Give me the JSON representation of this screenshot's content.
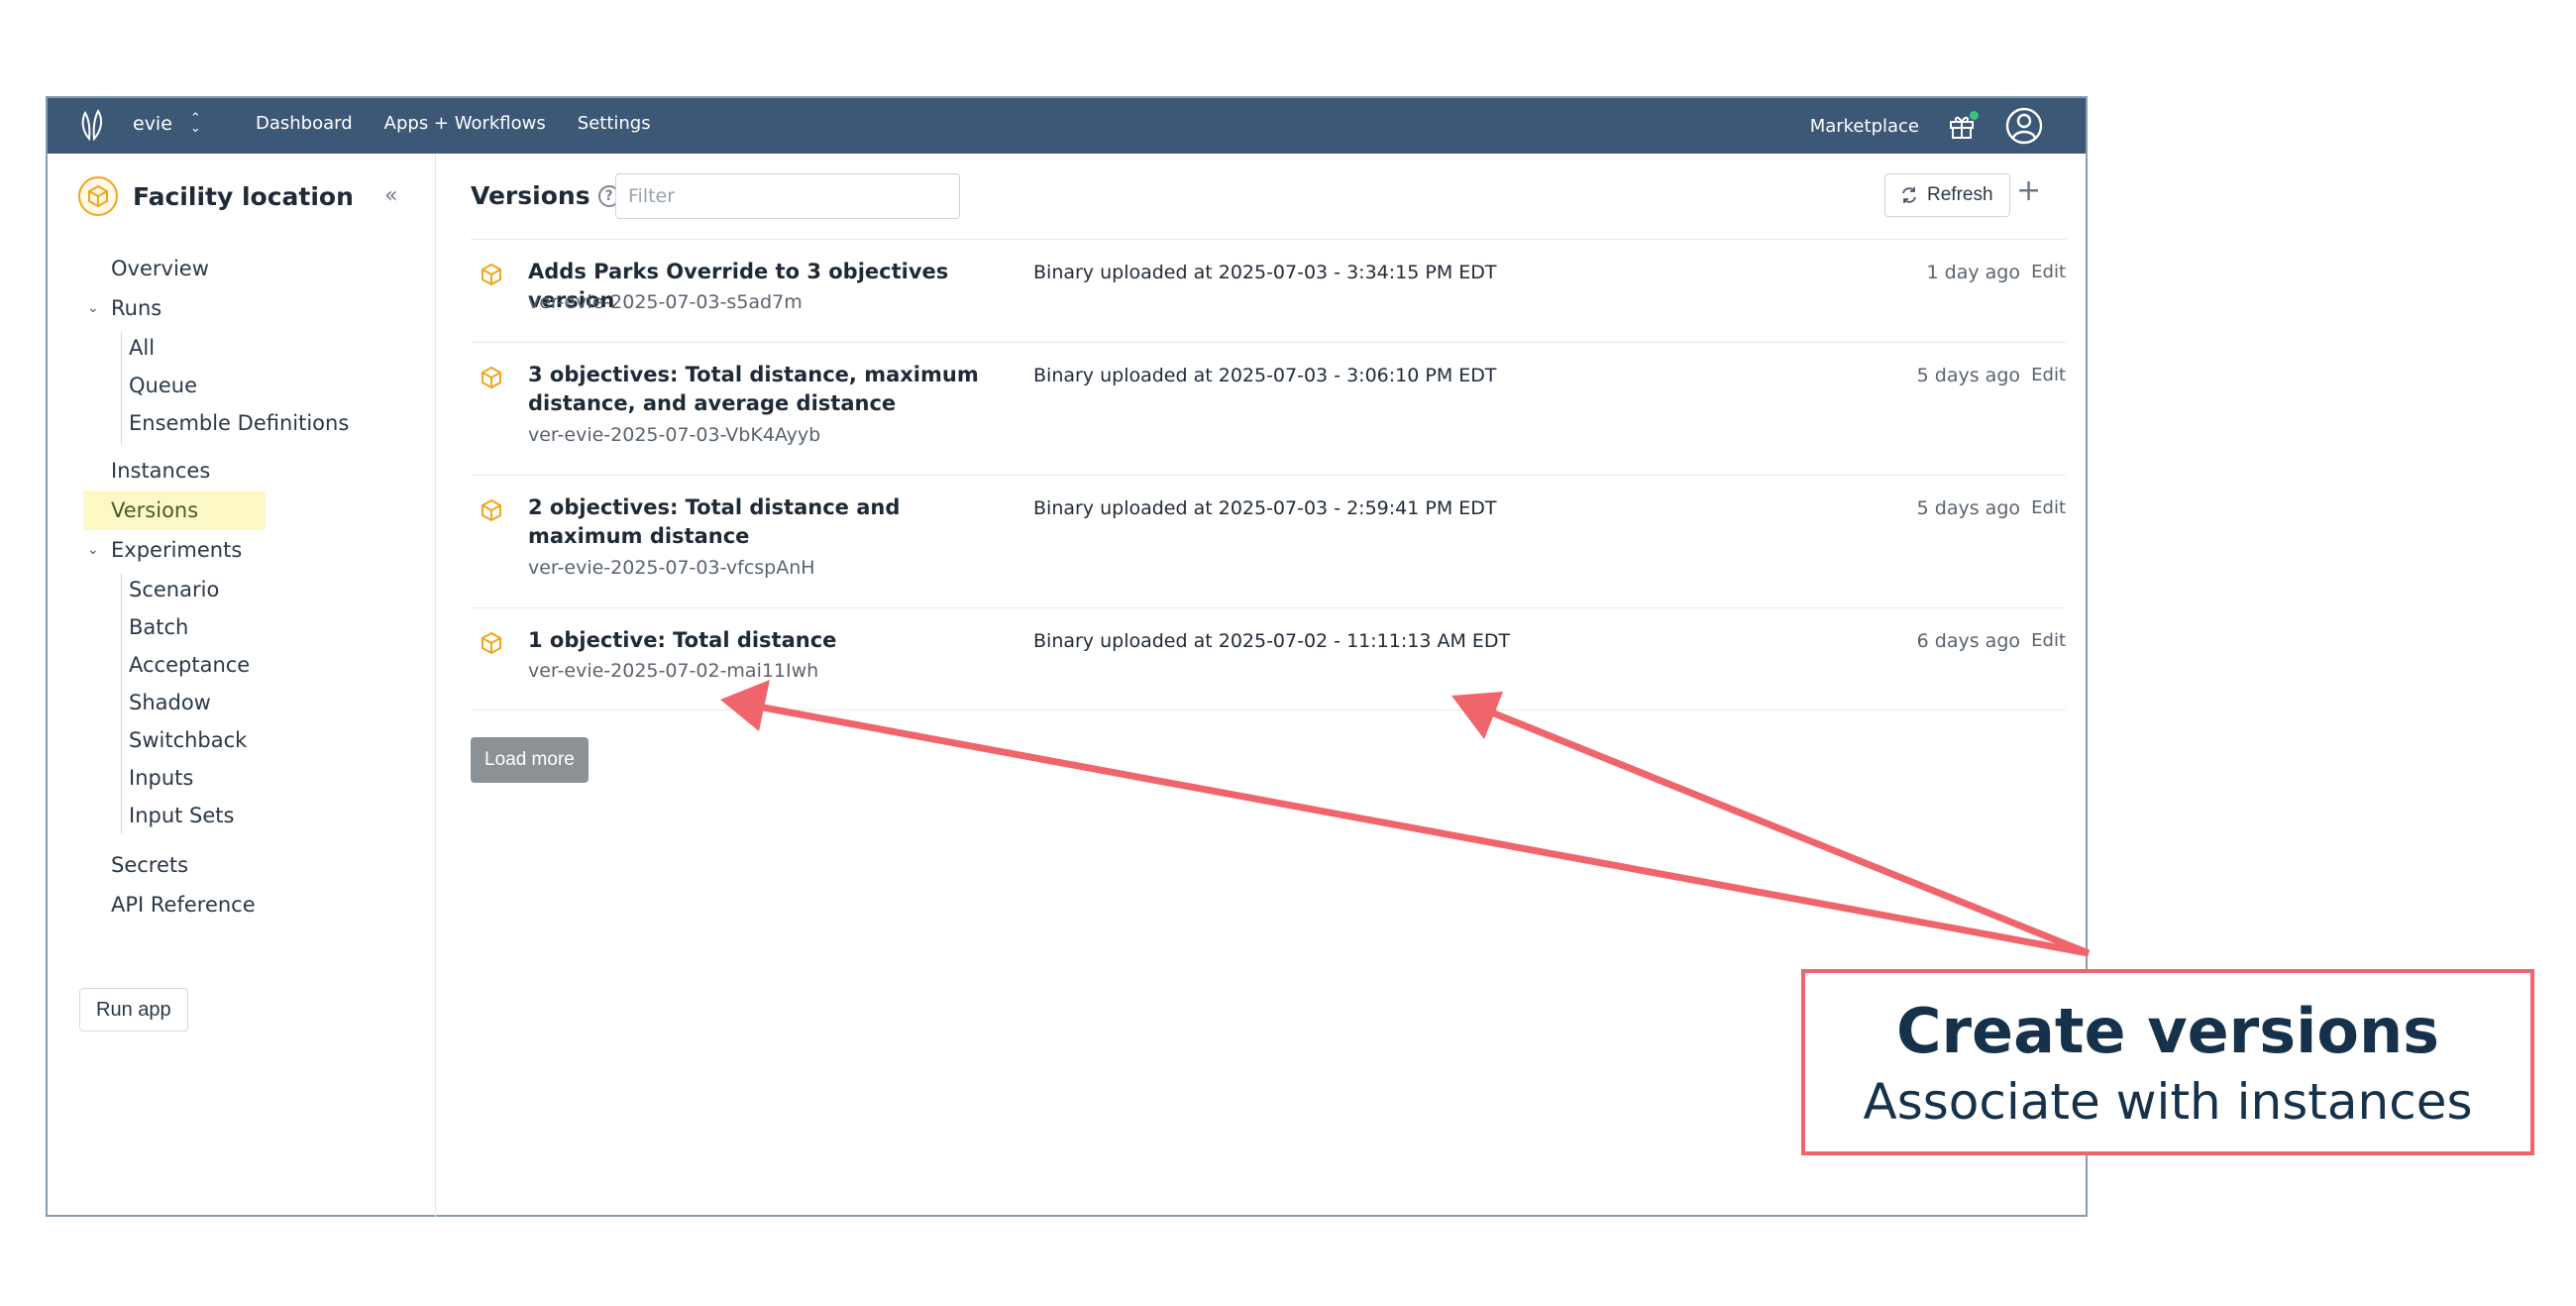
{
  "topnav": {
    "account": "evie",
    "links": [
      "Dashboard",
      "Apps + Workflows",
      "Settings"
    ],
    "marketplace": "Marketplace"
  },
  "sidebar": {
    "app_title": "Facility location",
    "items": [
      "Overview",
      "Runs",
      "All",
      "Queue",
      "Ensemble Definitions",
      "Instances",
      "Versions",
      "Experiments",
      "Scenario",
      "Batch",
      "Acceptance",
      "Shadow",
      "Switchback",
      "Inputs",
      "Input Sets",
      "Secrets",
      "API Reference"
    ],
    "run_button": "Run app"
  },
  "versions": {
    "heading": "Versions",
    "filter_placeholder": "Filter",
    "refresh_label": "Refresh",
    "load_more": "Load more",
    "edit_label": "Edit",
    "rows": [
      {
        "title": "Adds Parks Override to 3 objectives version",
        "id": "ver-evie-2025-07-03-s5ad7m",
        "uploaded": "Binary uploaded at 2025-07-03 - 3:34:15 PM EDT",
        "ago": "1 day ago"
      },
      {
        "title": "3 objectives: Total distance, maximum distance, and average distance",
        "id": "ver-evie-2025-07-03-VbK4Ayyb",
        "uploaded": "Binary uploaded at 2025-07-03 - 3:06:10 PM EDT",
        "ago": "5 days ago"
      },
      {
        "title": "2 objectives: Total distance and maximum distance",
        "id": "ver-evie-2025-07-03-vfcspAnH",
        "uploaded": "Binary uploaded at 2025-07-03 - 2:59:41 PM EDT",
        "ago": "5 days ago"
      },
      {
        "title": "1 objective: Total distance",
        "id": "ver-evie-2025-07-02-mai11Iwh",
        "uploaded": "Binary uploaded at 2025-07-02 - 11:11:13 AM EDT",
        "ago": "6 days ago"
      }
    ]
  },
  "callout": {
    "heading": "Create versions",
    "subheading": "Associate with instances"
  },
  "colors": {
    "nav_bg": "#3d5876",
    "accent_orange": "#f0a51c",
    "active_bg": "#fdf9c6",
    "callout_red": "#f0656b"
  }
}
